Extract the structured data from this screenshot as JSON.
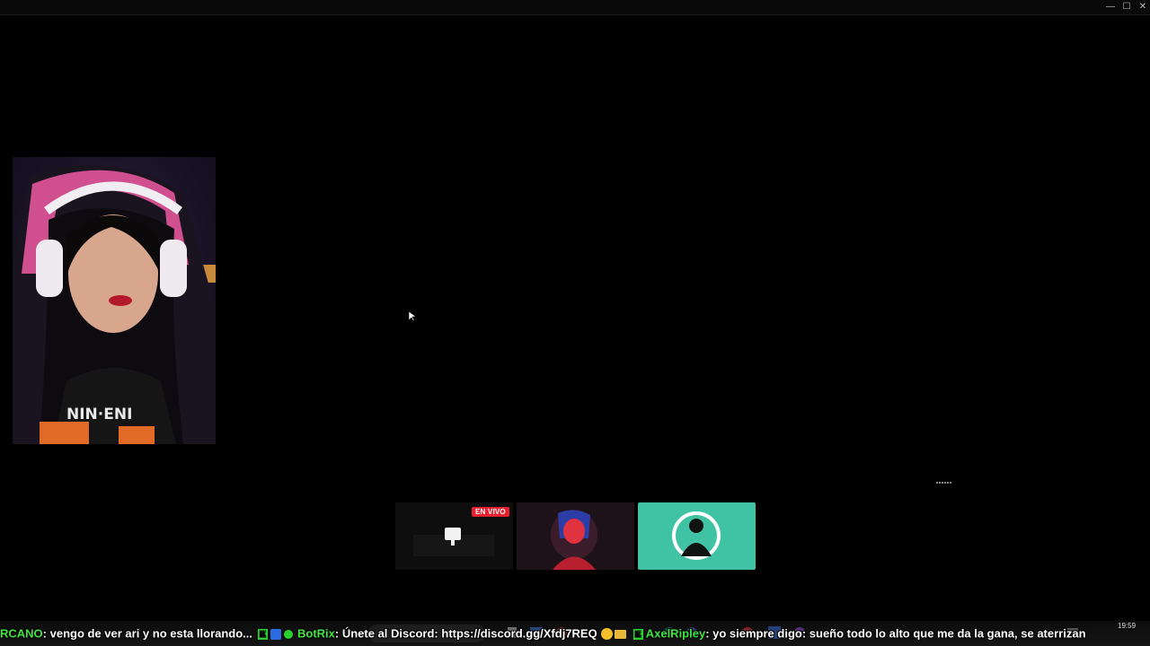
{
  "window": {
    "minimize_glyph": "—",
    "maximize_glyph": "☐",
    "close_glyph": "✕"
  },
  "stream": {
    "live_badge": "EN VIVO"
  },
  "ticker": {
    "first_user": "RCANO",
    "first_message": ": vengo de ver ari y no esta llorando...",
    "second_user": "BotRix",
    "second_message": ": Únete al Discord: https://discord.gg/Xfdj7REQ",
    "third_user": "AxelRipley",
    "third_message": ": yo siempre digo: sueño todo lo alto que me da la gana, se aterrizan"
  },
  "tray": {
    "time": "19:59"
  },
  "colors": {
    "live": "#e5202f",
    "chat_user": "#3fe63f",
    "teal_tile": "#40c2a4"
  },
  "icons": {
    "minimize": "minimize-icon",
    "maximize": "maximize-icon",
    "close": "close-icon",
    "cursor": "mouse-cursor-icon",
    "screen": "monitor-icon"
  }
}
